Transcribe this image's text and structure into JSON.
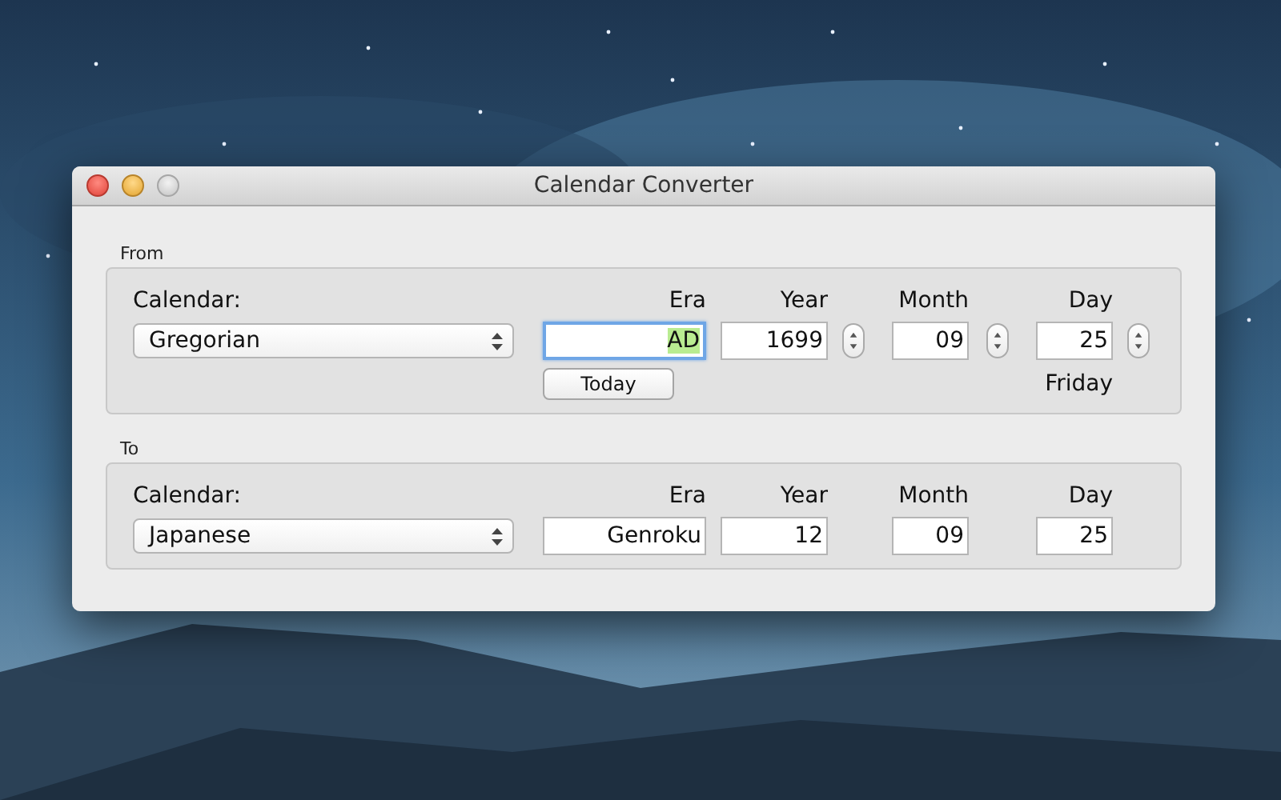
{
  "window": {
    "title": "Calendar Converter"
  },
  "sections": [
    {
      "legend": "From",
      "calendar_label": "Calendar:",
      "calendar": "Gregorian",
      "fields": [
        {
          "label": "Era",
          "value": "AD",
          "focused": true,
          "stepper": false
        },
        {
          "label": "Year",
          "value": "1699",
          "focused": false,
          "stepper": true
        },
        {
          "label": "Month",
          "value": "09",
          "focused": false,
          "stepper": true
        },
        {
          "label": "Day",
          "value": "25",
          "focused": false,
          "stepper": true
        }
      ],
      "button": "Today",
      "weekday": "Friday"
    },
    {
      "legend": "To",
      "calendar_label": "Calendar:",
      "calendar": "Japanese",
      "fields": [
        {
          "label": "Era",
          "value": "Genroku",
          "focused": false,
          "stepper": false
        },
        {
          "label": "Year",
          "value": "12",
          "focused": false,
          "stepper": false
        },
        {
          "label": "Month",
          "value": "09",
          "focused": false,
          "stepper": false
        },
        {
          "label": "Day",
          "value": "25",
          "focused": false,
          "stepper": false
        }
      ]
    }
  ]
}
